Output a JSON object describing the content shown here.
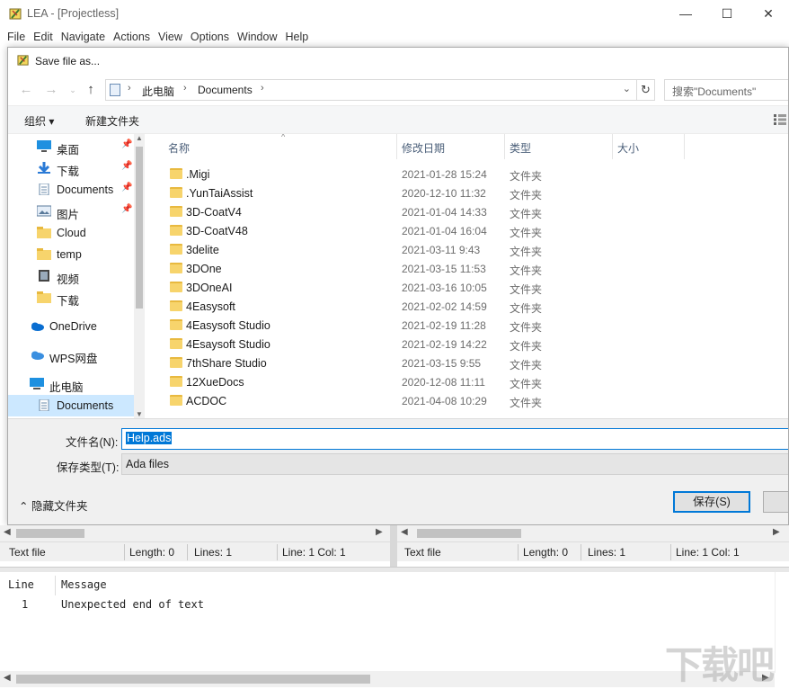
{
  "window": {
    "title": "LEA - [Projectless]",
    "controls": [
      "—",
      "☐",
      "✕"
    ]
  },
  "menu": [
    "File",
    "Edit",
    "Navigate",
    "Actions",
    "View",
    "Options",
    "Window",
    "Help"
  ],
  "dialog": {
    "title": "Save file as...",
    "breadcrumb": [
      "此电脑",
      "Documents"
    ],
    "search_placeholder": "搜索\"Documents\"",
    "organize_label": "组织 ▾",
    "new_folder_label": "新建文件夹",
    "nav_items": [
      {
        "label": "桌面",
        "icon": "desktop-icon",
        "pinned": true
      },
      {
        "label": "下载",
        "icon": "download-icon",
        "pinned": true
      },
      {
        "label": "Documents",
        "icon": "document-icon",
        "pinned": true
      },
      {
        "label": "图片",
        "icon": "pictures-icon",
        "pinned": true
      },
      {
        "label": "Cloud",
        "icon": "folder-icon",
        "pinned": false
      },
      {
        "label": "temp",
        "icon": "folder-icon",
        "pinned": false
      },
      {
        "label": "视频",
        "icon": "video-icon",
        "pinned": false
      },
      {
        "label": "下载",
        "icon": "folder-icon",
        "pinned": false
      },
      {
        "label": "OneDrive",
        "icon": "onedrive-icon",
        "pinned": false
      },
      {
        "label": "WPS网盘",
        "icon": "cloud-icon",
        "pinned": false
      },
      {
        "label": "此电脑",
        "icon": "computer-icon",
        "pinned": false
      },
      {
        "label": "Documents",
        "icon": "document-icon",
        "pinned": false,
        "selected": true
      }
    ],
    "columns": [
      "名称",
      "修改日期",
      "类型",
      "大小"
    ],
    "files": [
      {
        "name": ".Migi",
        "date": "2021-01-28 15:24",
        "type": "文件夹"
      },
      {
        "name": ".YunTaiAssist",
        "date": "2020-12-10 11:32",
        "type": "文件夹"
      },
      {
        "name": "3D-CoatV4",
        "date": "2021-01-04 14:33",
        "type": "文件夹"
      },
      {
        "name": "3D-CoatV48",
        "date": "2021-01-04 16:04",
        "type": "文件夹"
      },
      {
        "name": "3delite",
        "date": "2021-03-11 9:43",
        "type": "文件夹"
      },
      {
        "name": "3DOne",
        "date": "2021-03-15 11:53",
        "type": "文件夹"
      },
      {
        "name": "3DOneAI",
        "date": "2021-03-16 10:05",
        "type": "文件夹"
      },
      {
        "name": "4Easysoft",
        "date": "2021-02-02 14:59",
        "type": "文件夹"
      },
      {
        "name": "4Easysoft Studio",
        "date": "2021-02-19 11:28",
        "type": "文件夹"
      },
      {
        "name": "4Esaysoft Studio",
        "date": "2021-02-19 14:22",
        "type": "文件夹"
      },
      {
        "name": "7thShare Studio",
        "date": "2021-03-15 9:55",
        "type": "文件夹"
      },
      {
        "name": "12XueDocs",
        "date": "2020-12-08 11:11",
        "type": "文件夹"
      },
      {
        "name": "ACDOC",
        "date": "2021-04-08 10:29",
        "type": "文件夹"
      }
    ],
    "filename_label": "文件名(N):",
    "filename_value": "Help.ads",
    "filetype_label": "保存类型(T):",
    "filetype_value": "Ada files",
    "hide_folders_label": "隐藏文件夹",
    "save_label": "保存(S)"
  },
  "left_status": {
    "type": "Text file",
    "length": "Length: 0",
    "lines": "Lines: 1",
    "pos": "Line: 1 Col: 1"
  },
  "right_status": {
    "type": "Text file",
    "length": "Length: 0",
    "lines": "Lines: 1",
    "pos": "Line: 1 Col: 1"
  },
  "messages": {
    "headers": [
      "Line",
      "Message"
    ],
    "rows": [
      {
        "line": "1",
        "message": "Unexpected end of text"
      }
    ]
  },
  "watermark": "下载吧"
}
